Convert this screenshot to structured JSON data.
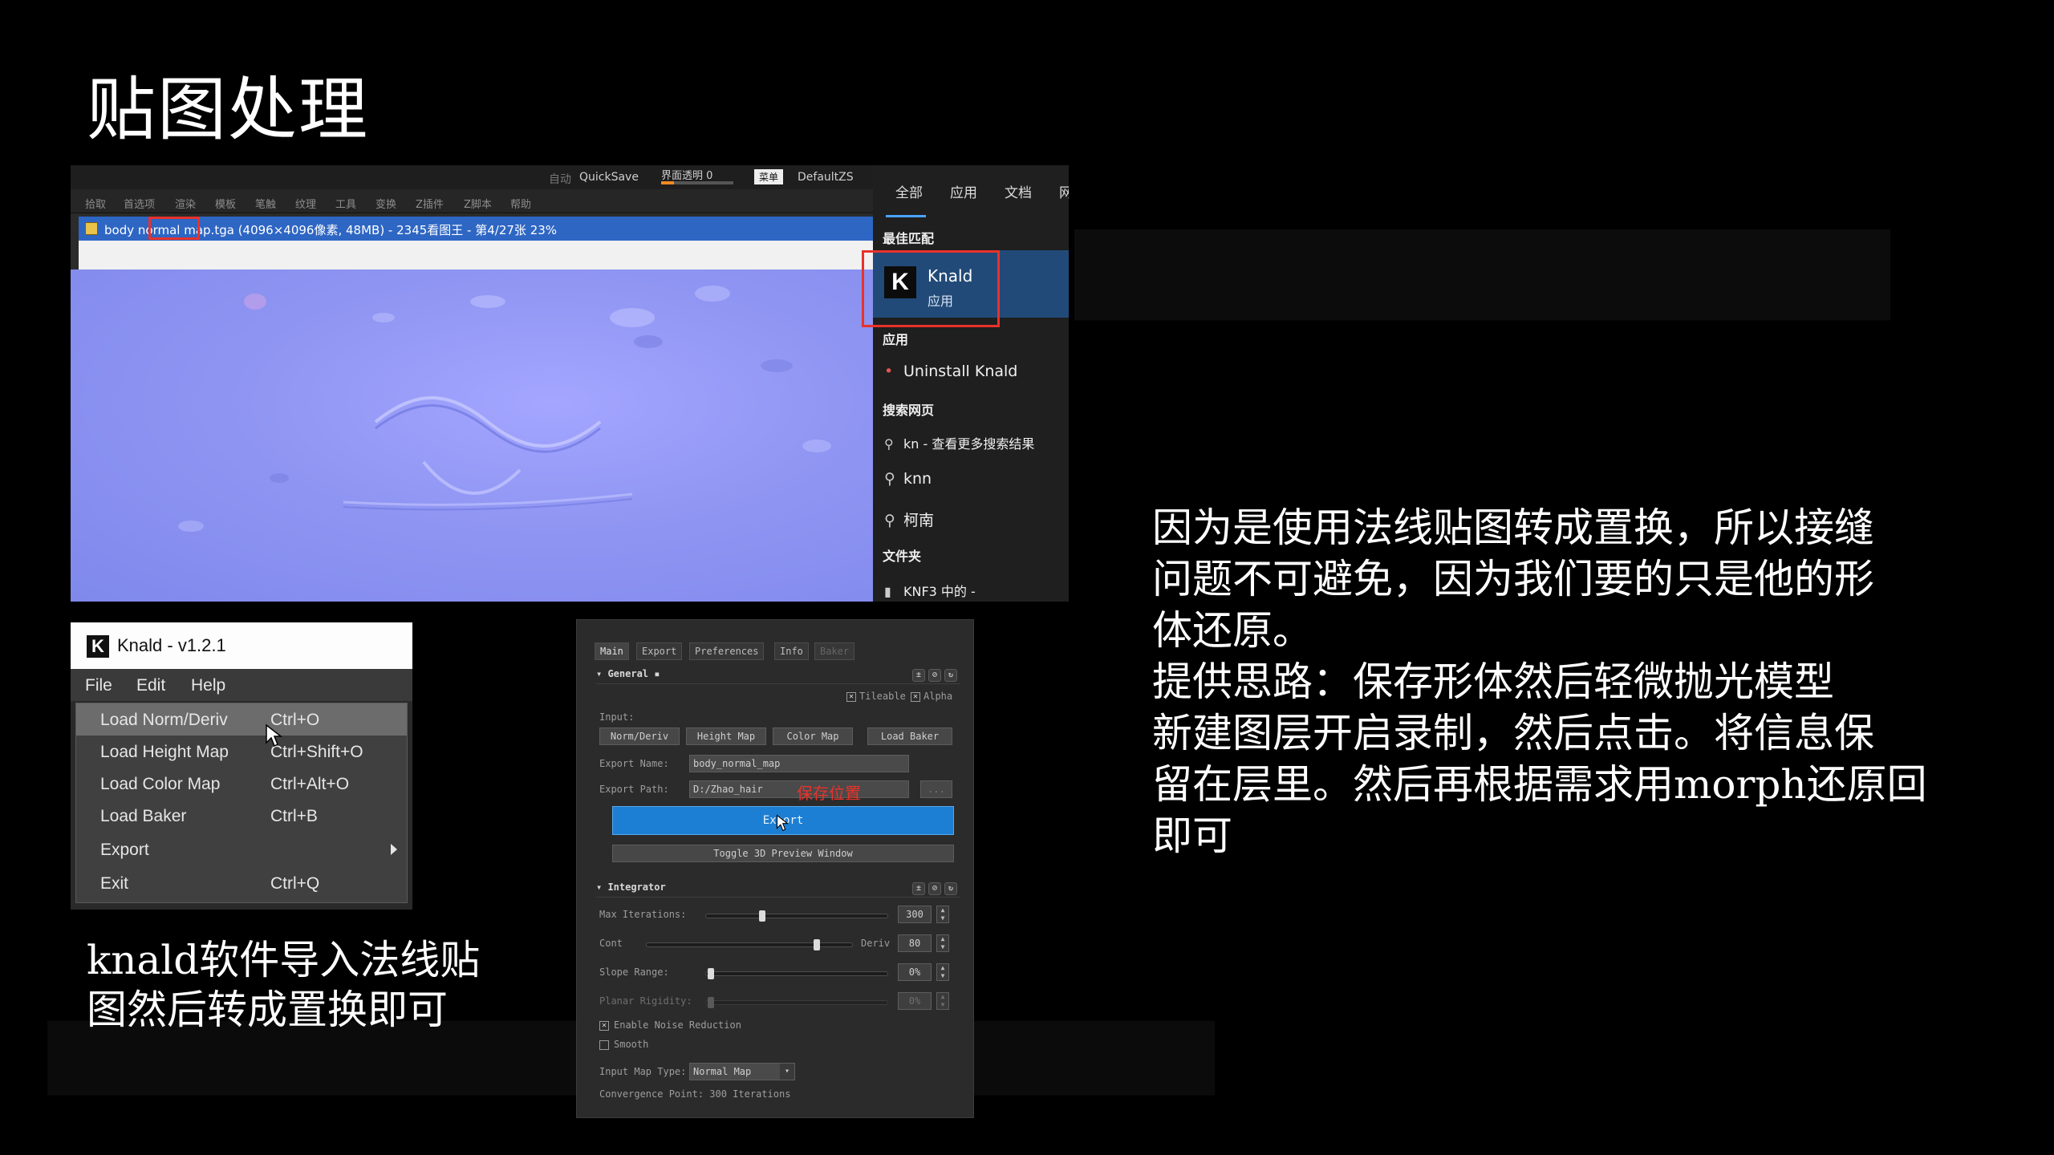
{
  "slide": {
    "title": "贴图处理",
    "caption_left": "knald软件导入法线贴\n图然后转成置换即可",
    "explain_lines": [
      "因为是使用法线贴图转成置换，所以接缝\n问题不可避免，因为我们要的只是他的形\n体还原。",
      "提供思路：保存形体然后轻微抛光模型",
      "新建图层开启录制，然后点击。将信息保\n留在层里。然后再根据需求用morph还原回\n即可"
    ]
  },
  "zbrush": {
    "top_auto": "自动",
    "quicksave": "QuickSave",
    "transparency_label": "界面透明 0",
    "menu_badge": "菜单",
    "default_script": "DefaultZS",
    "menu": [
      "拾取",
      "首选项",
      "渲染",
      "模板",
      "笔触",
      "纹理",
      "工具",
      "变换",
      "Z插件",
      "Z脚本",
      "帮助"
    ],
    "file_title_pre": "body",
    "file_title_hl": "normal",
    "file_title_post": "map.tga (4096×4096像素, 48MB) - 2345看图王 - 第4/27张 23%"
  },
  "windows_search": {
    "tabs": [
      "全部",
      "应用",
      "文档",
      "网"
    ],
    "best_match_label": "最佳匹配",
    "best_match_name": "Knald",
    "best_match_sub": "应用",
    "apps_label": "应用",
    "uninstall": "Uninstall Knald",
    "web_label": "搜索网页",
    "web_results": [
      "kn - 查看更多搜索结果",
      "knn",
      "柯南"
    ],
    "folders_label": "文件夹",
    "folder_item": "KNF3 中的 -"
  },
  "knald_menu": {
    "window_title": "Knald - v1.2.1",
    "menubar": [
      "File",
      "Edit",
      "Help"
    ],
    "items": [
      {
        "label": "Load Norm/Deriv",
        "shortcut": "Ctrl+O"
      },
      {
        "label": "Load Height Map",
        "shortcut": "Ctrl+Shift+O"
      },
      {
        "label": "Load Color Map",
        "shortcut": "Ctrl+Alt+O"
      },
      {
        "label": "Load Baker",
        "shortcut": "Ctrl+B"
      },
      {
        "label": "Export",
        "shortcut": ""
      },
      {
        "label": "Exit",
        "shortcut": "Ctrl+Q"
      }
    ],
    "selected_index": 0
  },
  "knald_panel": {
    "tabs": [
      "Main",
      "Export",
      "Preferences",
      "Info",
      "Baker"
    ],
    "general": "General",
    "tileable": "Tileable",
    "alpha": "Alpha",
    "input_label": "Input:",
    "input_buttons": [
      "Norm/Deriv",
      "Height Map",
      "Color Map",
      "Load Baker"
    ],
    "export_name_label": "Export Name:",
    "export_name_value": "body_normal_map",
    "export_path_label": "Export Path:",
    "export_path_value": "D:/Zhao_hair",
    "browse": "...",
    "red_annotation": "保存位置",
    "export_button": "Export",
    "toggle_button": "Toggle 3D Preview Window",
    "integrator": "Integrator",
    "max_iterations_label": "Max Iterations:",
    "max_iterations": "300",
    "cont_label": "Cont",
    "deriv_label": "Deriv",
    "cont_deriv": "80",
    "slope_range_label": "Slope Range:",
    "slope_range": "0%",
    "planar_rigidity_label": "Planar Rigidity:",
    "planar_rigidity": "0%",
    "enable_noise": "Enable Noise Reduction",
    "smooth": "Smooth",
    "input_map_type_label": "Input Map Type:",
    "input_map_type": "Normal Map",
    "convergence": "Convergence Point: 300 Iterations"
  },
  "colors": {
    "background": "#000000",
    "highlight_red": "#e8322b",
    "search_selected": "#214a78",
    "export_blue": "#1d7fd3",
    "normal_map": "#8f95f2"
  }
}
